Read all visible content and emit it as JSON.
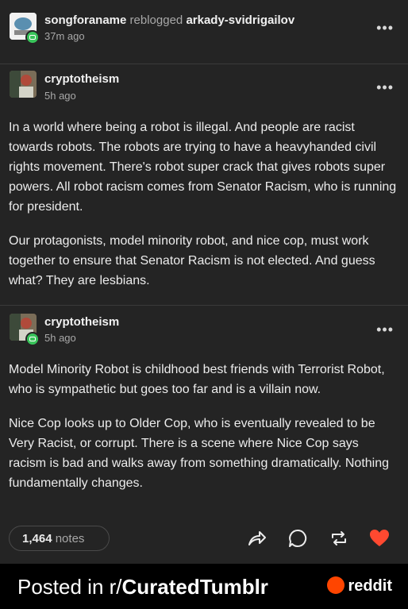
{
  "reblog_header": {
    "username": "songforaname",
    "action": "reblogged",
    "source": "arkady-svidrigailov",
    "time": "37m ago"
  },
  "posts": [
    {
      "username": "cryptotheism",
      "time": "5h ago",
      "paragraphs": [
        "In a world where being a robot is illegal. And people are racist towards robots. The robots are trying to have a heavyhanded civil rights movement. There's robot super crack that gives robots super powers. All robot racism comes from Senator Racism, who is running for president.",
        "Our protagonists, model minority robot, and nice cop, must work together to ensure that Senator Racism is not elected. And guess what? They are lesbians."
      ]
    },
    {
      "username": "cryptotheism",
      "time": "5h ago",
      "paragraphs": [
        "Model Minority Robot is childhood best friends with Terrorist Robot, who is sympathetic but goes too far and is a villain now.",
        "Nice Cop looks up to Older Cop, who is eventually revealed to be Very Racist, or corrupt. There is a scene where Nice Cop says racism is bad and walks away from something dramatically. Nothing fundamentally changes."
      ]
    }
  ],
  "footer_bar": {
    "notes_count": "1,464",
    "notes_label": "notes",
    "icons": [
      "share-icon",
      "reply-icon",
      "reblog-icon",
      "like-icon"
    ],
    "like_color": "#ff4930"
  },
  "banner": {
    "prefix": "Posted in r/",
    "subreddit": "CuratedTumblr",
    "brand": "reddit",
    "brand_color": "#ff4500"
  },
  "more_label": "•••"
}
